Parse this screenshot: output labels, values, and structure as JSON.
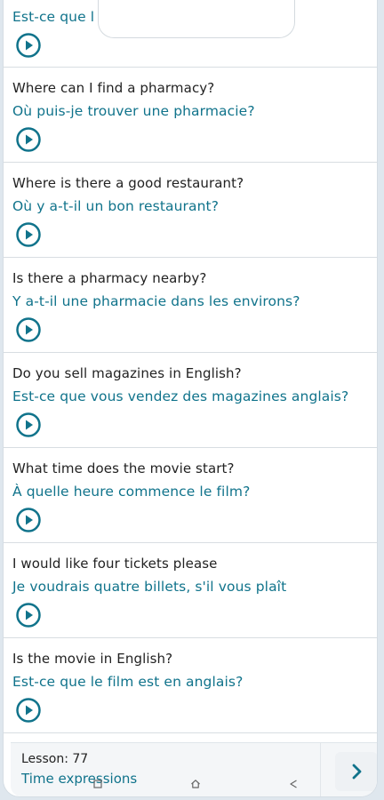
{
  "phrases": [
    {
      "french": "Est-ce que l",
      "partial": true
    },
    {
      "english": "Where can I find a pharmacy?",
      "french": "Où puis-je trouver une pharmacie?"
    },
    {
      "english": "Where is there a good restaurant?",
      "french": "Où y a-t-il un bon restaurant?"
    },
    {
      "english": "Is there a pharmacy nearby?",
      "french": "Y a-t-il une pharmacie dans les environs?"
    },
    {
      "english": "Do you sell magazines in English?",
      "french": "Est-ce que vous vendez des magazines anglais?"
    },
    {
      "english": "What time does the movie start?",
      "french": "À quelle heure commence le film?"
    },
    {
      "english": "I would like four tickets please",
      "french": "Je voudrais quatre billets, s'il vous plaît"
    },
    {
      "english": "Is the movie in English?",
      "french": "Est-ce que le film est en anglais?"
    }
  ],
  "footer": {
    "lesson_number": "Lesson: 77",
    "lesson_title": "Time expressions"
  },
  "icons": {
    "play": "play-circle-icon",
    "next": "chevron-right-icon",
    "recent": "recent-apps-icon",
    "home": "home-icon",
    "back": "back-triangle-icon"
  },
  "colors": {
    "accent": "#10738b",
    "text": "#222222",
    "divider": "#d8dde2",
    "background": "#ffffff"
  }
}
